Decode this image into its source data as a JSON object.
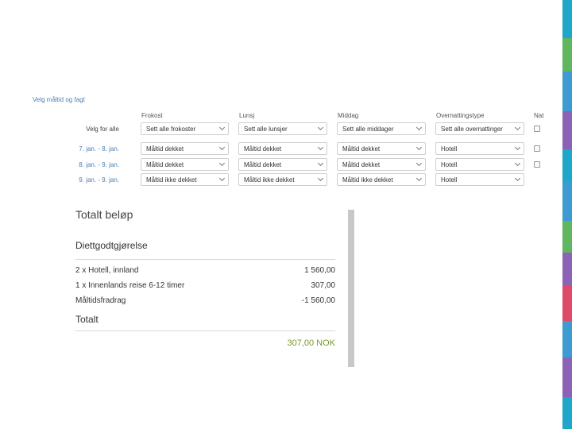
{
  "section_title": "Velg måltid og fagt",
  "columns": {
    "breakfast": "Frokost",
    "lunch": "Lunsj",
    "dinner": "Middag",
    "overnight": "Overnattingstype",
    "night": "Nat"
  },
  "rows": [
    {
      "label": "Velg for alle",
      "breakfast": "Sett alle frokoster",
      "lunch": "Sett alle lunsjer",
      "dinner": "Sett alle middager",
      "overnight": "Sett alle overnattinger"
    },
    {
      "label": "7. jan. - 8. jan.",
      "breakfast": "Måltid dekket",
      "lunch": "Måltid dekket",
      "dinner": "Måltid dekket",
      "overnight": "Hotell"
    },
    {
      "label": "8. jan. - 9. jan.",
      "breakfast": "Måltid dekket",
      "lunch": "Måltid dekket",
      "dinner": "Måltid dekket",
      "overnight": "Hotell"
    },
    {
      "label": "9. jan. - 9. jan.",
      "breakfast": "Måltid ikke dekket",
      "lunch": "Måltid ikke dekket",
      "dinner": "Måltid ikke dekket",
      "overnight": "Hotell"
    }
  ],
  "summary": {
    "title": "Totalt beløp",
    "subtitle": "Diettgodtgjørelse",
    "items": [
      {
        "label": "2 x Hotell, innland",
        "amount": "1 560,00"
      },
      {
        "label": "1 x Innenlands reise 6-12 timer",
        "amount": "307,00"
      },
      {
        "label": "Måltidsfradrag",
        "amount": "-1 560,00"
      }
    ],
    "total_label": "Totalt",
    "total_amount": "307,00 NOK"
  },
  "colors": {
    "link": "#4a7fb0",
    "total": "#7a9a2a",
    "stripes": [
      "#5fb65f",
      "#3d9bd1",
      "#8c62b5",
      "#1fa7c9",
      "#e04a6a",
      "#5fb65f",
      "#3d9bd1",
      "#8c62b5",
      "#3d9bd1",
      "#1fa7c9"
    ]
  }
}
